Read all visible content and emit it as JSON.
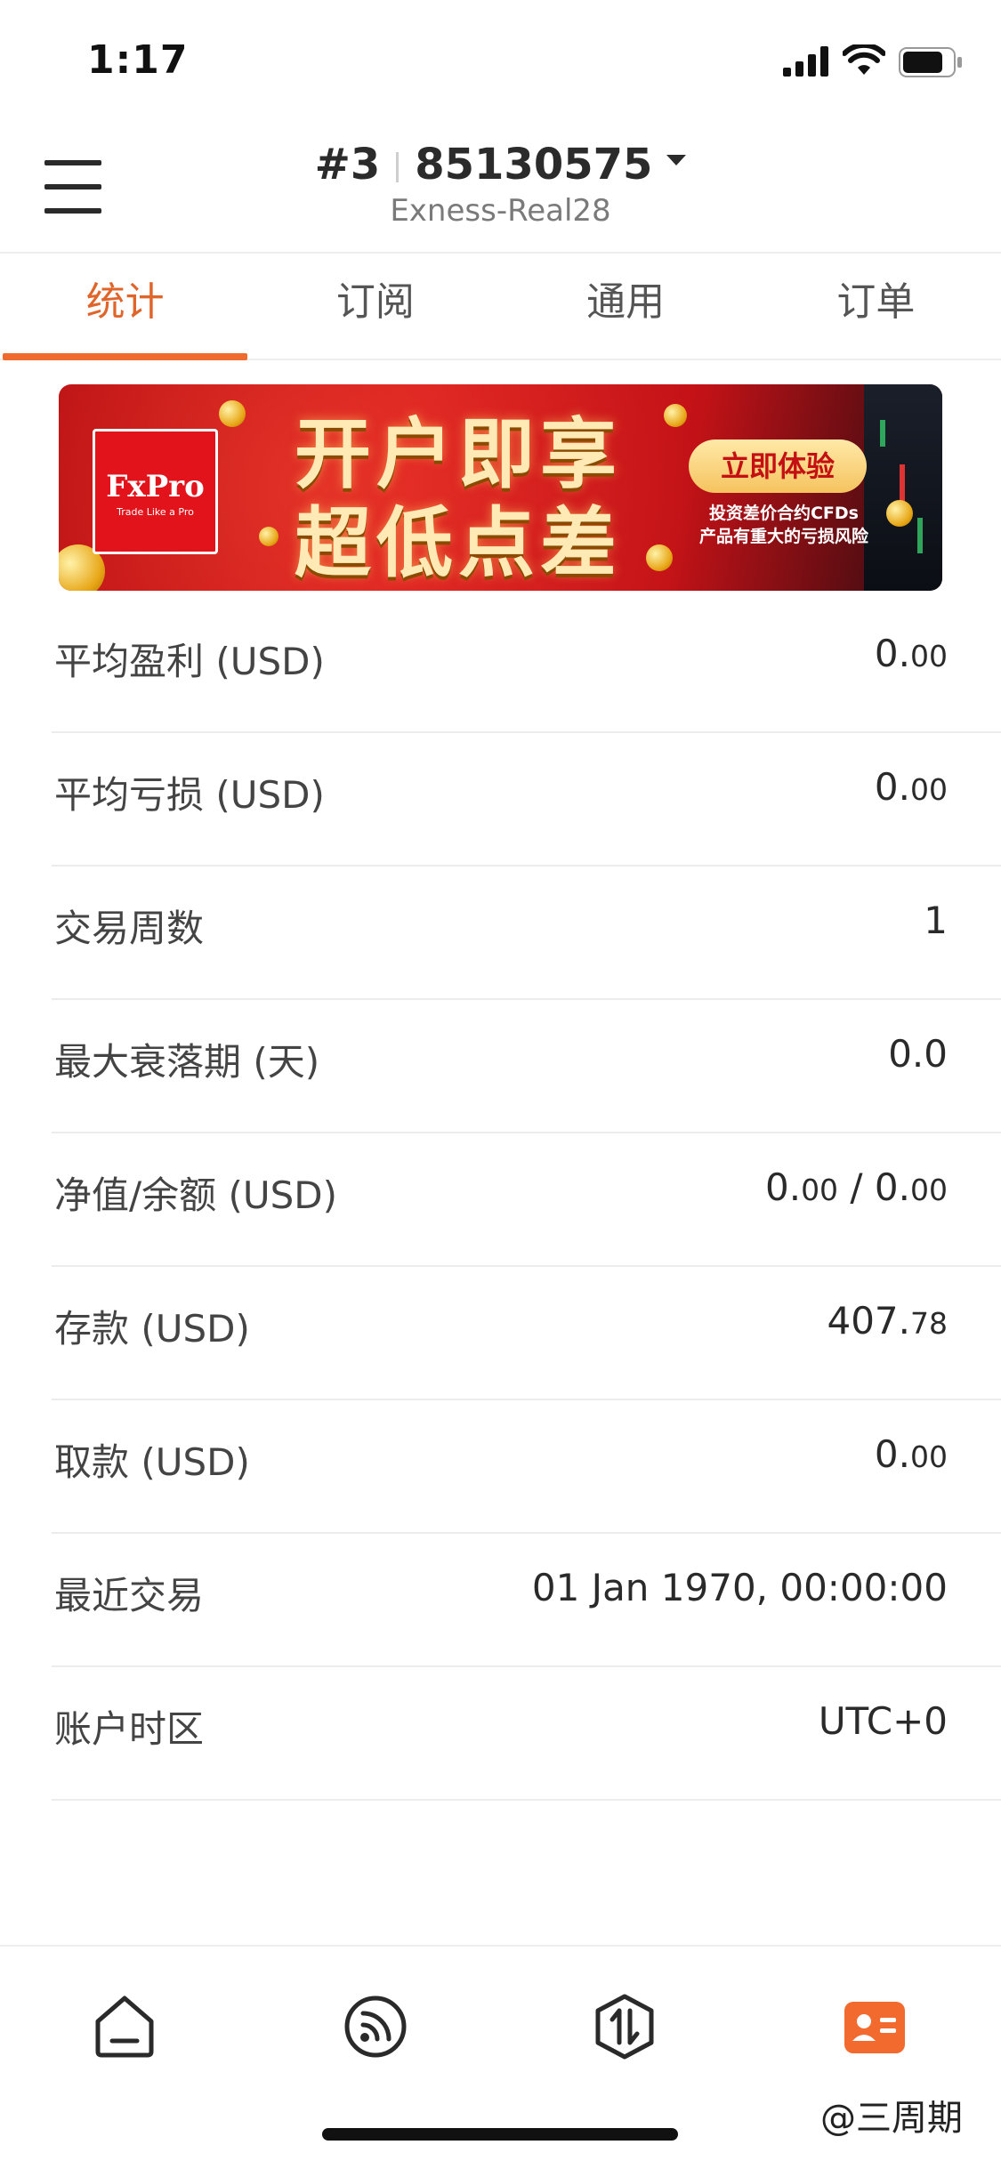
{
  "status_bar": {
    "time": "1:17"
  },
  "header": {
    "account_index": "#3",
    "account_number": "85130575",
    "server": "Exness-Real28"
  },
  "tabs": [
    {
      "label": "统计",
      "active": true
    },
    {
      "label": "订阅",
      "active": false
    },
    {
      "label": "通用",
      "active": false
    },
    {
      "label": "订单",
      "active": false
    }
  ],
  "banner": {
    "logo_text": "FxPro",
    "logo_tagline": "Trade Like a Pro",
    "headline_line1": "开户即享",
    "headline_line2": "超低点差",
    "cta_label": "立即体验",
    "risk_line1": "投资差价合约CFDs",
    "risk_line2": "产品有重大的亏损风险"
  },
  "stats": [
    {
      "label": "平均盈利 (USD)",
      "value_main": "0.",
      "value_small": "00"
    },
    {
      "label": "平均亏损 (USD)",
      "value_main": "0.",
      "value_small": "00"
    },
    {
      "label": "交易周数",
      "value_main": "1",
      "value_small": ""
    },
    {
      "label": "最大衰落期 (天)",
      "value_main": "0.0",
      "value_small": ""
    },
    {
      "label": "净值/余额 (USD)",
      "value_main": "0.",
      "value_small": "00",
      "value_main2": " / 0.",
      "value_small2": "00"
    },
    {
      "label": "存款 (USD)",
      "value_main": "407.",
      "value_small": "78"
    },
    {
      "label": "取款 (USD)",
      "value_main": "0.",
      "value_small": "00"
    },
    {
      "label": "最近交易",
      "value_main": "01 Jan 1970, 00:00:00",
      "value_small": ""
    },
    {
      "label": "账户时区",
      "value_main": "UTC+0",
      "value_small": ""
    }
  ],
  "bottom_nav": [
    {
      "icon": "home-icon",
      "active": false
    },
    {
      "icon": "signal-feed-icon",
      "active": false
    },
    {
      "icon": "trade-icon",
      "active": false
    },
    {
      "icon": "account-card-icon",
      "active": true
    }
  ],
  "colors": {
    "accent": "#ef6a2e",
    "banner_red": "#d4151a"
  },
  "watermark": "@三周期"
}
